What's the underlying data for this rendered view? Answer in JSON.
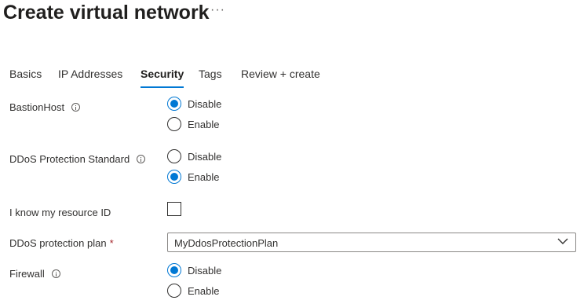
{
  "header": {
    "title": "Create virtual network",
    "more_label": "···"
  },
  "tabs": [
    {
      "label": "Basics",
      "active": false
    },
    {
      "label": "IP Addresses",
      "active": false
    },
    {
      "label": "Security",
      "active": true
    },
    {
      "label": "Tags",
      "active": false
    },
    {
      "label": "Review + create",
      "active": false
    }
  ],
  "form": {
    "bastion_host": {
      "label": "BastionHost",
      "options": [
        "Disable",
        "Enable"
      ],
      "selected": "Disable"
    },
    "ddos_standard": {
      "label": "DDoS Protection Standard",
      "options": [
        "Disable",
        "Enable"
      ],
      "selected": "Enable"
    },
    "know_resource_id": {
      "label": "I know my resource ID",
      "checked": false
    },
    "ddos_plan": {
      "label": "DDoS protection plan",
      "required_marker": "*",
      "value": "MyDdosProtectionPlan"
    },
    "firewall": {
      "label": "Firewall",
      "options": [
        "Disable",
        "Enable"
      ],
      "selected": "Disable"
    }
  },
  "colors": {
    "accent": "#0078d4",
    "text": "#323130",
    "required": "#a4262c"
  }
}
